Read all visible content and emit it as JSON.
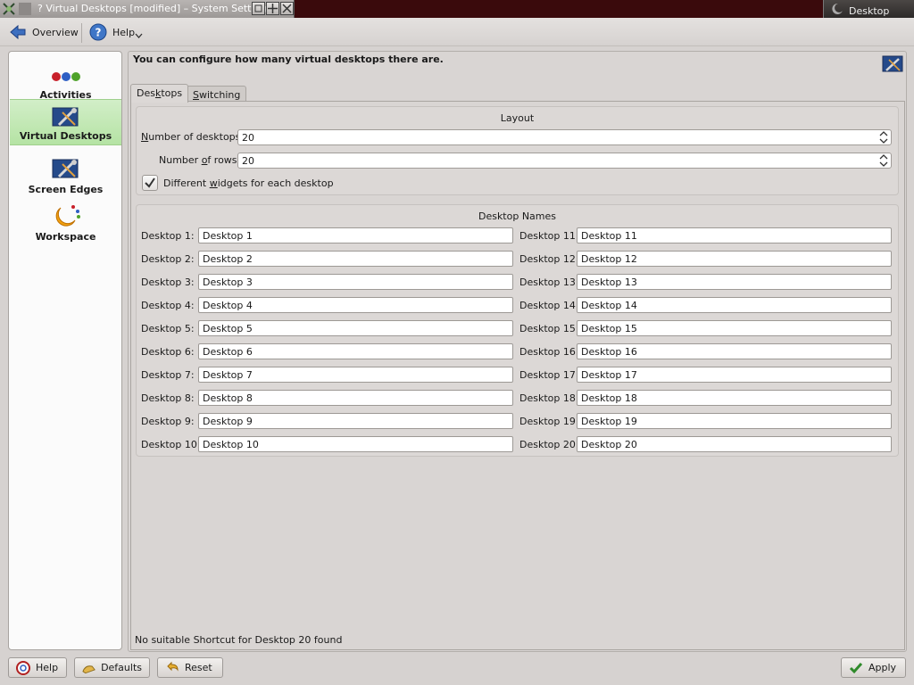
{
  "window": {
    "title": "? Virtual Desktops [modified] – System Settings",
    "taskbar_label": "Desktop"
  },
  "toolbar": {
    "overview_label": "Overview",
    "help_label": "Help"
  },
  "sidebar": {
    "items": [
      {
        "label": "Activities"
      },
      {
        "label": "Virtual Desktops",
        "active": true
      },
      {
        "label": "Screen Edges"
      },
      {
        "label": "Workspace"
      }
    ]
  },
  "main": {
    "description": "You can configure how many virtual desktops there are.",
    "tabs": [
      {
        "label_pre": "Des",
        "label_mnemonic": "k",
        "label_post": "tops",
        "active": true
      },
      {
        "label_pre": "",
        "label_mnemonic": "S",
        "label_post": "witching",
        "active": false
      }
    ],
    "layout": {
      "title": "Layout",
      "num_desktops_label_mnemonic": "N",
      "num_desktops_label_rest": "umber of desktops:",
      "num_desktops_value": "20",
      "num_rows_label_pre": "Number ",
      "num_rows_label_mnemonic": "o",
      "num_rows_label_post": "f rows:",
      "num_rows_value": "20",
      "checkbox_label_pre": "Different ",
      "checkbox_label_mnemonic": "w",
      "checkbox_label_post": "idgets for each desktop",
      "checkbox_checked": true
    },
    "desktop_names": {
      "title": "Desktop Names",
      "left": [
        {
          "label": "Desktop 1:",
          "value": "Desktop 1"
        },
        {
          "label": "Desktop 2:",
          "value": "Desktop 2"
        },
        {
          "label": "Desktop 3:",
          "value": "Desktop 3"
        },
        {
          "label": "Desktop 4:",
          "value": "Desktop 4"
        },
        {
          "label": "Desktop 5:",
          "value": "Desktop 5"
        },
        {
          "label": "Desktop 6:",
          "value": "Desktop 6"
        },
        {
          "label": "Desktop 7:",
          "value": "Desktop 7"
        },
        {
          "label": "Desktop 8:",
          "value": "Desktop 8"
        },
        {
          "label": "Desktop 9:",
          "value": "Desktop 9"
        },
        {
          "label": "Desktop 10:",
          "value": "Desktop 10"
        }
      ],
      "right": [
        {
          "label": "Desktop 11:",
          "value": "Desktop 11"
        },
        {
          "label": "Desktop 12:",
          "value": "Desktop 12"
        },
        {
          "label": "Desktop 13:",
          "value": "Desktop 13"
        },
        {
          "label": "Desktop 14:",
          "value": "Desktop 14"
        },
        {
          "label": "Desktop 15:",
          "value": "Desktop 15"
        },
        {
          "label": "Desktop 16:",
          "value": "Desktop 16"
        },
        {
          "label": "Desktop 17:",
          "value": "Desktop 17"
        },
        {
          "label": "Desktop 18:",
          "value": "Desktop 18"
        },
        {
          "label": "Desktop 19:",
          "value": "Desktop 19"
        },
        {
          "label": "Desktop 20:",
          "value": "Desktop 20"
        }
      ]
    },
    "status": "No suitable Shortcut for Desktop 20 found"
  },
  "buttons": {
    "help": "Help",
    "defaults": "Defaults",
    "reset": "Reset",
    "apply": "Apply"
  },
  "colors": {
    "titlebar_bg": "#3a0a0c",
    "active_item_bg": "#b5e3a4",
    "window_bg": "#d6d2d0"
  }
}
